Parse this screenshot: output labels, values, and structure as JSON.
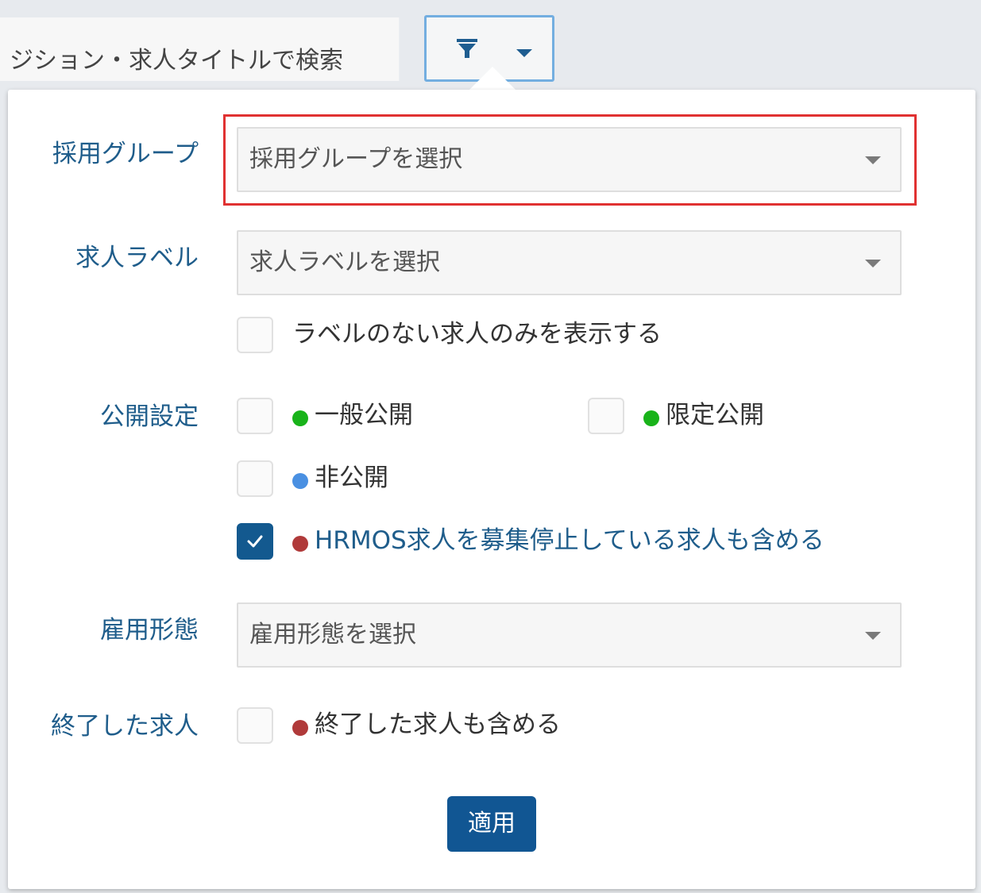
{
  "search": {
    "placeholder_visible": "ジション・求人タイトルで検索"
  },
  "filter_button": {
    "icon": "filter-funnel-icon",
    "dropdown_icon": "caret-down-icon"
  },
  "panel": {
    "group": {
      "label": "採用グループ",
      "placeholder": "採用グループを選択",
      "highlight_color": "#e03131"
    },
    "job_label": {
      "label": "求人ラベル",
      "placeholder": "求人ラベルを選択",
      "option_no_label": "ラベルのない求人のみを表示する"
    },
    "visibility": {
      "label": "公開設定",
      "options": [
        {
          "text": "一般公開",
          "dot_color": "#19b31a",
          "checked": false
        },
        {
          "text": "限定公開",
          "dot_color": "#19b31a",
          "checked": false
        },
        {
          "text": "非公開",
          "dot_color": "#4a90e2",
          "checked": false
        },
        {
          "text": "HRMOS求人を募集停止している求人も含める",
          "dot_color": "#b03a3a",
          "checked": true
        }
      ]
    },
    "employment": {
      "label": "雇用形態",
      "placeholder": "雇用形態を選択"
    },
    "ended": {
      "label": "終了した求人",
      "option": "終了した求人も含める",
      "dot_color": "#b03a3a"
    },
    "apply_label": "適用",
    "accent_color": "#115693"
  }
}
